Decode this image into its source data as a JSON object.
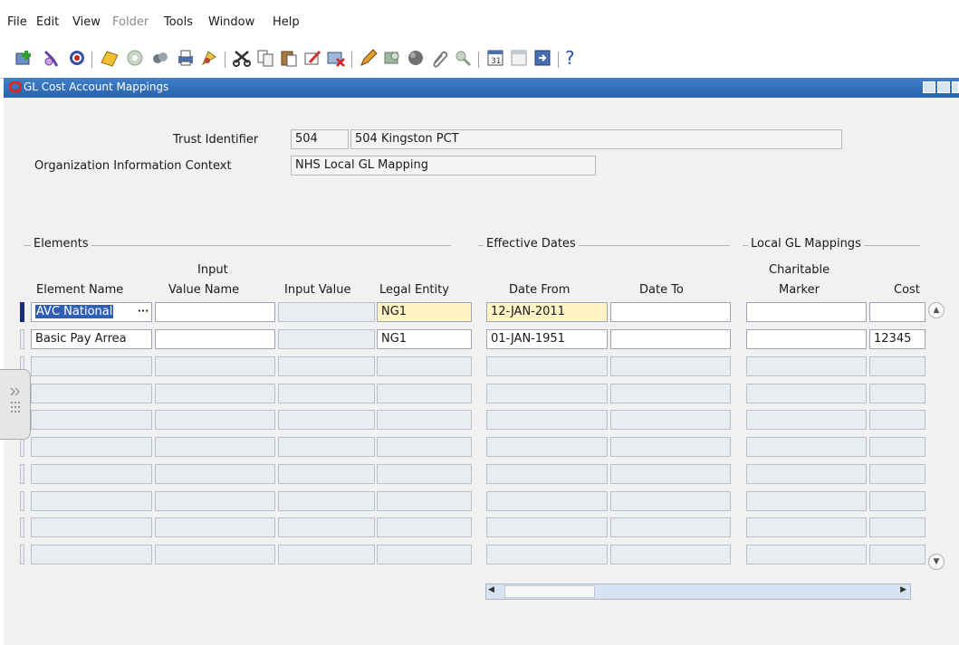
{
  "menu": [
    "File",
    "Edit",
    "View",
    "Folder",
    "Tools",
    "Window",
    "Help"
  ],
  "menu_disabled": [
    "Folder"
  ],
  "toolbar": {
    "icons": [
      "new-record-icon",
      "find-icon",
      "navigator-icon",
      "open-folder-icon",
      "save-icon",
      "switch-responsibility-icon",
      "print-icon",
      "close-form-icon",
      "cut-icon",
      "copy-icon",
      "paste-icon",
      "clear-record-icon",
      "delete-record-icon",
      "edit-field-icon",
      "zoom-icon",
      "translations-icon",
      "attachments-icon",
      "folder-tools-icon",
      "calendar-icon",
      "close-window-icon",
      "window-help-icon"
    ],
    "help_glyph": "?"
  },
  "window": {
    "title": "GL Cost Account Mappings"
  },
  "header": {
    "trust_identifier_label": "Trust Identifier",
    "trust_identifier_value": "504",
    "trust_identifier_desc": "504 Kingston PCT",
    "org_info_context_label": "Organization Information Context",
    "org_info_context_value": "NHS Local GL Mapping"
  },
  "groups": {
    "elements": "Elements",
    "effective_dates": "Effective Dates",
    "local_gl_mappings": "Local GL Mappings"
  },
  "columns": {
    "element_name": "Element Name",
    "input_value_name_1": "Input",
    "input_value_name_2": "Value Name",
    "input_value": "Input Value",
    "legal_entity": "Legal Entity",
    "date_from": "Date From",
    "date_to": "Date To",
    "charitable_marker_1": "Charitable",
    "charitable_marker_2": "Marker",
    "cost": "Cost"
  },
  "lov_glyph": "···",
  "rows": [
    {
      "element_name": "AVC National",
      "input_value_name": "",
      "input_value": "",
      "legal_entity": "NG1",
      "date_from": "12-JAN-2011",
      "date_to": "",
      "charitable_marker": "",
      "cost": ""
    },
    {
      "element_name": "Basic Pay Arrea",
      "input_value_name": "",
      "input_value": "",
      "legal_entity": "NG1",
      "date_from": "01-JAN-1951",
      "date_to": "",
      "charitable_marker": "",
      "cost": "12345"
    }
  ],
  "empty_row_count": 8,
  "colors": {
    "titlebar": "#2f6fbf",
    "required_field": "#fff2c4",
    "selection": "#2f5fb3",
    "current_record_indicator": "#1e2a7a",
    "oracle_red": "#e2231a"
  }
}
